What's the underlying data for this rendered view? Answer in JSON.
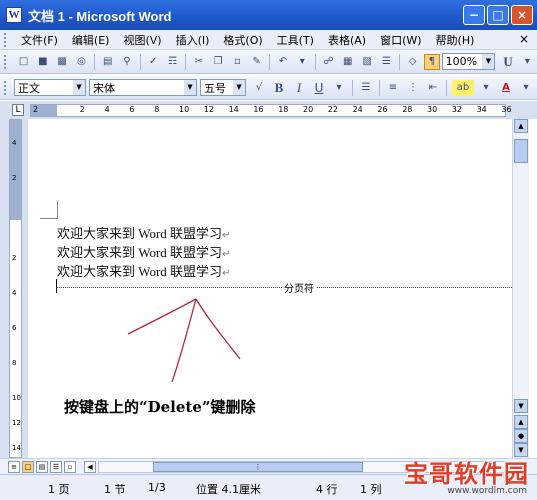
{
  "window": {
    "app_icon": "W",
    "title": "文档 1 - Microsoft Word",
    "minimize": "−",
    "restore": "□",
    "close": "×"
  },
  "menu": {
    "items": [
      "文件(F)",
      "编辑(E)",
      "视图(V)",
      "插入(I)",
      "格式(O)",
      "工具(T)",
      "表格(A)",
      "窗口(W)",
      "帮助(H)"
    ],
    "close_doc": "×"
  },
  "toolbar_standard": {
    "zoom": "100%",
    "icons": [
      "new-document-icon",
      "open-folder-icon",
      "save-icon",
      "permission-icon",
      "print-icon",
      "print-preview-icon",
      "spelling-icon",
      "research-icon",
      "cut-icon",
      "copy-icon",
      "paste-icon",
      "format-painter-icon",
      "undo-icon",
      "hyperlink-icon",
      "tables-borders-icon",
      "insert-table-icon",
      "columns-icon",
      "drawing-icon",
      "show-hide-icon",
      "zoom-dropdown-icon"
    ]
  },
  "toolbar_format": {
    "style": "正文",
    "font": "宋体",
    "size": "五号",
    "bold": "B",
    "italic": "I",
    "underline": "U",
    "font_color": "A",
    "highlight": "ab"
  },
  "ruler": {
    "corner": "L",
    "numbers": [
      "2",
      "2",
      "4",
      "6",
      "8",
      "10",
      "12",
      "14",
      "16",
      "18",
      "20",
      "22",
      "24",
      "26",
      "28",
      "30",
      "32",
      "34",
      "36"
    ],
    "vertical_numbers": [
      "4",
      "2",
      "2",
      "4",
      "6",
      "8",
      "10",
      "12",
      "14"
    ]
  },
  "document": {
    "lines": [
      "欢迎大家来到 Word 联盟学习",
      "欢迎大家来到 Word 联盟学习",
      "欢迎大家来到 Word 联盟学习"
    ],
    "paragraph_mark": "↵",
    "page_break_label": "分页符",
    "annotation": "按键盘上的“Delete”键删除"
  },
  "status": {
    "page": "1 页",
    "section": "1 节",
    "page_of": "1/3",
    "position": "位置 4.1厘米",
    "line": "4 行",
    "column": "1 列"
  },
  "watermark": {
    "text": "宝哥软件园",
    "url": "www.wordlm.com"
  },
  "colors": {
    "title_bar": "#2f6fe0",
    "ink": "#b0283a",
    "watermark": "#e23d2a"
  }
}
